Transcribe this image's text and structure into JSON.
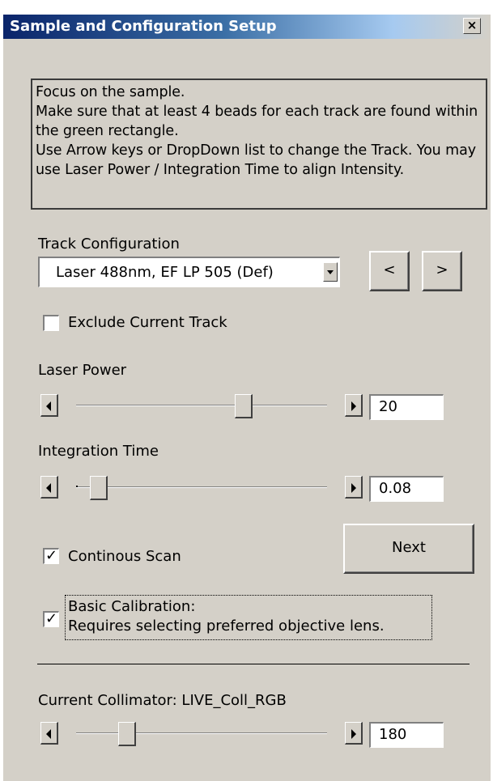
{
  "window": {
    "title": "Sample and Configuration Setup",
    "close_glyph": "×"
  },
  "instructions": {
    "text": "Focus on the sample.\nMake sure that at least 4 beads for each track are found within the green rectangle.\nUse Arrow keys or DropDown list to change the Track. You may use Laser Power / Integration Time to align Intensity."
  },
  "track_config": {
    "label": "Track Configuration",
    "selected": "Laser 488nm, EF LP 505 (Def)",
    "prev_label": "<",
    "next_label": ">",
    "exclude_label": "Exclude Current Track",
    "exclude_checked": false
  },
  "laser_power": {
    "label": "Laser Power",
    "value": "20",
    "slider_fraction": 0.68
  },
  "integration_time": {
    "label": "Integration Time",
    "value": "0.08",
    "slider_fraction": 0.06
  },
  "continuous_scan": {
    "label": "Continous Scan",
    "checked": true,
    "check_glyph": "✓"
  },
  "next_button": {
    "label": "Next"
  },
  "basic_calibration": {
    "label_line1": "Basic Calibration:",
    "label_line2": "Requires selecting preferred objective lens.",
    "checked": true,
    "check_glyph": "✓"
  },
  "collimator": {
    "label": "Current Collimator: LIVE_Coll_RGB",
    "value": "180",
    "slider_fraction": 0.18
  },
  "icons": {
    "close": "close-icon",
    "dropdown": "chevron-down-icon",
    "slider_left": "arrow-left-icon",
    "slider_right": "arrow-right-icon"
  }
}
